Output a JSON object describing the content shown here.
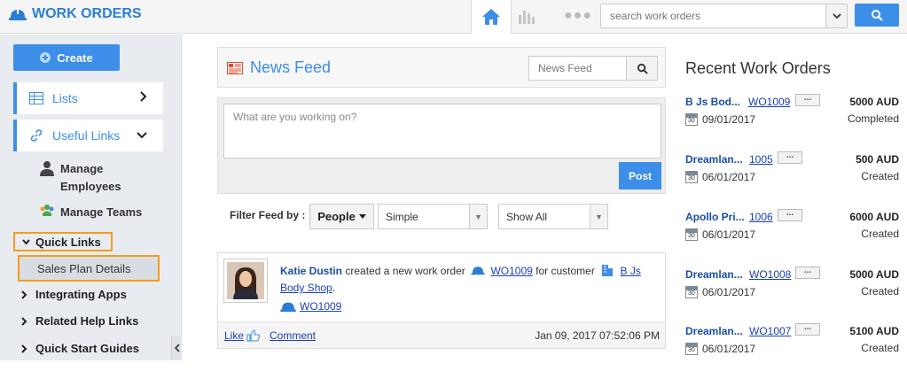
{
  "app": {
    "title": "WORK ORDERS"
  },
  "top": {
    "search_placeholder": "search work orders"
  },
  "sidebar": {
    "create_label": "Create",
    "lists_label": "Lists",
    "useful_links_label": "Useful Links",
    "manage_employees": "Manage Employees",
    "manage_teams": "Manage Teams",
    "quick_links": "Quick Links",
    "sales_plan_details": "Sales Plan Details",
    "integrating_apps": "Integrating Apps",
    "related_help_links": "Related Help Links",
    "quick_start_guides": "Quick Start Guides"
  },
  "feed": {
    "title": "News Feed",
    "search_placeholder": "News Feed",
    "compose_placeholder": "What are you working on?",
    "post_label": "Post",
    "filter_label": "Filter Feed by :",
    "people_label": "People",
    "type_value": "Simple",
    "scope_value": "Show All",
    "item": {
      "author": "Katie Dustin",
      "action": "created a new work order",
      "wo_code": "WO1009",
      "for_text": "for customer",
      "customer": "B Js Body Shop",
      "wo_code_2": "WO1009",
      "like": "Like",
      "comment": "Comment",
      "timestamp": "Jan 09, 2017 07:52:06 PM"
    }
  },
  "recent": {
    "title": "Recent Work Orders",
    "orders": [
      {
        "name": "B Js Bod...",
        "code": "WO1009",
        "amount": "5000 AUD",
        "date": "09/01/2017",
        "status": "Completed"
      },
      {
        "name": "Dreamlan...",
        "code": "1005",
        "amount": "500 AUD",
        "date": "06/01/2017",
        "status": "Created"
      },
      {
        "name": "Apollo Pri...",
        "code": "1006",
        "amount": "6000 AUD",
        "date": "06/01/2017",
        "status": "Created"
      },
      {
        "name": "Dreamlan...",
        "code": "WO1008",
        "amount": "5000 AUD",
        "date": "06/01/2017",
        "status": "Created"
      },
      {
        "name": "Dreamlan...",
        "code": "WO1007",
        "amount": "5100 AUD",
        "date": "06/01/2017",
        "status": "Created"
      }
    ]
  },
  "colors": {
    "accent": "#3d8ee8",
    "highlight": "#f59d1a",
    "link": "#1a3fb5"
  }
}
